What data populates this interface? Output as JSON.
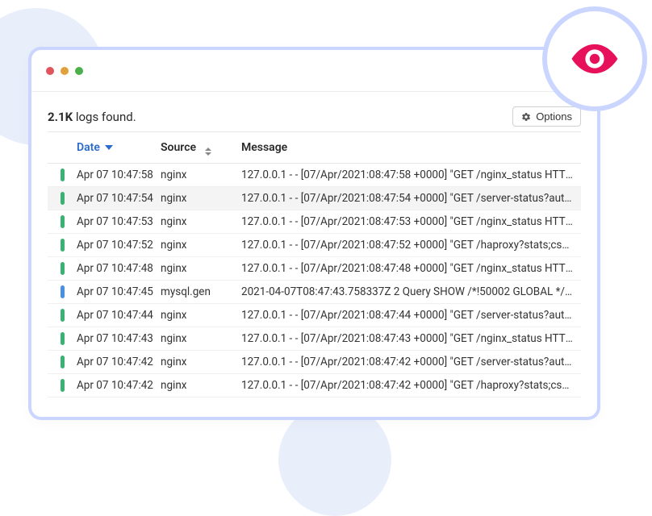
{
  "header": {
    "count": "2.1K",
    "found_suffix": " logs found.",
    "options_label": "Options"
  },
  "columns": {
    "date": "Date",
    "source": "Source",
    "message": "Message"
  },
  "colors": {
    "green": "#3BB273",
    "blue": "#4A90E2"
  },
  "rows": [
    {
      "date": "Apr 07 10:47:58",
      "source": "nginx",
      "pill": "green",
      "hover": false,
      "message": "127.0.0.1 - - [07/Apr/2021:08:47:58 +0000] \"GET /nginx_status HTTP/..."
    },
    {
      "date": "Apr 07 10:47:54",
      "source": "nginx",
      "pill": "green",
      "hover": true,
      "message": "127.0.0.1 - - [07/Apr/2021:08:47:54 +0000] \"GET /server-status?auto ..."
    },
    {
      "date": "Apr 07 10:47:53",
      "source": "nginx",
      "pill": "green",
      "hover": false,
      "message": "127.0.0.1 - - [07/Apr/2021:08:47:53 +0000] \"GET /nginx_status HTTP/..."
    },
    {
      "date": "Apr 07 10:47:52",
      "source": "nginx",
      "pill": "green",
      "hover": false,
      "message": "127.0.0.1 - - [07/Apr/2021:08:47:52 +0000] \"GET /haproxy?stats;csv H..."
    },
    {
      "date": "Apr 07 10:47:48",
      "source": "nginx",
      "pill": "green",
      "hover": false,
      "message": "127.0.0.1 - - [07/Apr/2021:08:47:48 +0000] \"GET /nginx_status HTTP/..."
    },
    {
      "date": "Apr 07 10:47:45",
      "source": "mysql.gen",
      "pill": "blue",
      "hover": false,
      "message": "2021-04-07T08:47:43.758337Z 2 Query SHOW /*!50002 GLOBAL */ S..."
    },
    {
      "date": "Apr 07 10:47:44",
      "source": "nginx",
      "pill": "green",
      "hover": false,
      "message": "127.0.0.1 - - [07/Apr/2021:08:47:44 +0000] \"GET /server-status?auto ..."
    },
    {
      "date": "Apr 07 10:47:43",
      "source": "nginx",
      "pill": "green",
      "hover": false,
      "message": "127.0.0.1 - - [07/Apr/2021:08:47:43 +0000] \"GET /nginx_status HTTP/..."
    },
    {
      "date": "Apr 07 10:47:42",
      "source": "nginx",
      "pill": "green",
      "hover": false,
      "message": "127.0.0.1 - - [07/Apr/2021:08:47:42 +0000] \"GET /server-status?auto= ..."
    },
    {
      "date": "Apr 07 10:47:42",
      "source": "nginx",
      "pill": "green",
      "hover": false,
      "message": "127.0.0.1 - - [07/Apr/2021:08:47:42 +0000] \"GET /haproxy?stats;csv H..."
    }
  ]
}
